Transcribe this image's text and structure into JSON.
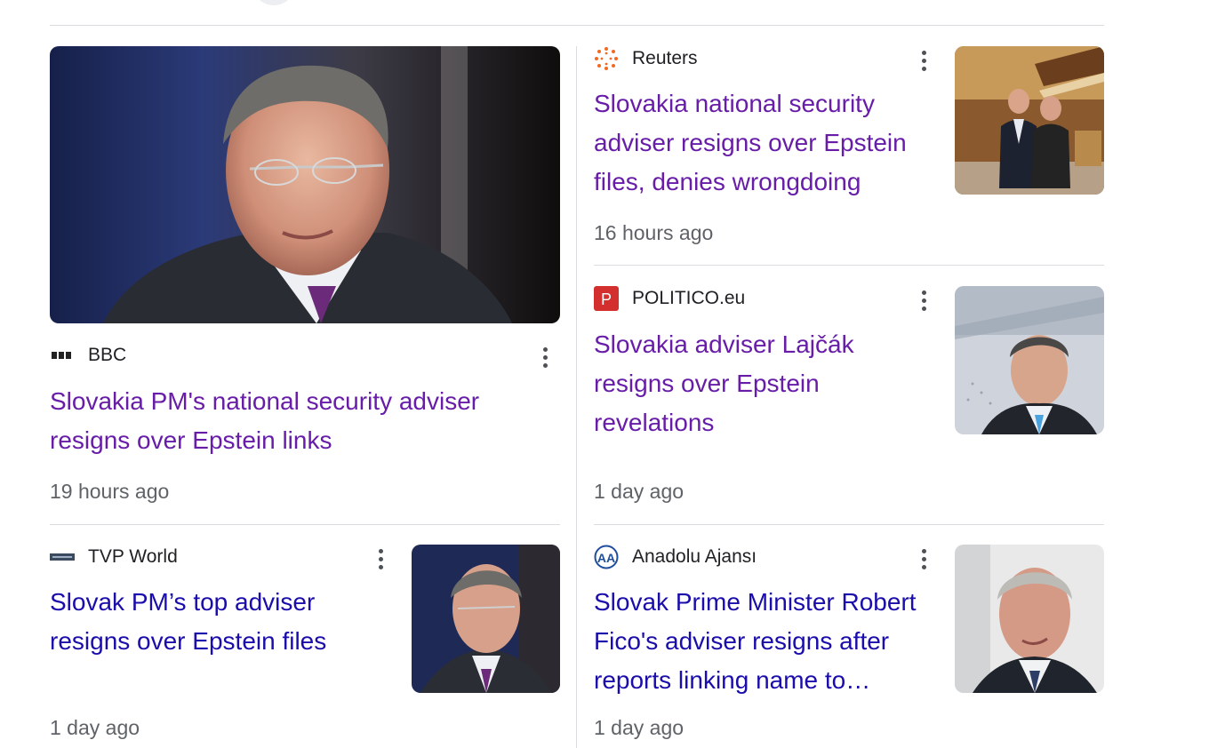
{
  "articles": [
    {
      "source": "BBC",
      "logo_icon": "bbc-logo-icon",
      "headline": "Slovakia PM's national security adviser resigns over Epstein links",
      "time": "19 hours ago",
      "visited": true
    },
    {
      "source": "Reuters",
      "logo_icon": "reuters-logo-icon",
      "headline": "Slovakia national security adviser resigns over Epstein files, denies wrongdoing",
      "time": "16 hours ago",
      "visited": true
    },
    {
      "source": "POLITICO.eu",
      "logo_icon": "politico-logo-icon",
      "headline": "Slovakia adviser Lajčák resigns over Epstein revelations",
      "time": "1 day ago",
      "visited": true
    },
    {
      "source": "TVP World",
      "logo_icon": "tvp-world-logo-icon",
      "headline": "Slovak PM’s top adviser resigns over Epstein files",
      "time": "1 day ago",
      "visited": false
    },
    {
      "source": "Anadolu Ajansı",
      "logo_icon": "anadolu-logo-icon",
      "headline": "Slovak Prime Minister Robert Fico's adviser resigns after reports linking name to…",
      "time": "1 day ago",
      "visited": false
    }
  ],
  "colors": {
    "visited_link": "#681da8",
    "link": "#1a0dab",
    "meta_text": "#5f6368",
    "divider": "#dadce0",
    "politico_red": "#d32f2f",
    "reuters_orange": "#f26a21",
    "anadolu_blue": "#1f4e9c"
  }
}
